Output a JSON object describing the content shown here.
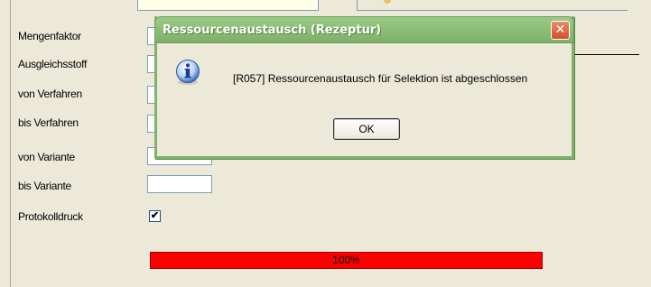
{
  "form": {
    "labels": {
      "mengenfaktor": "Mengenfaktor",
      "ausgleichsstoff": "Ausgleichsstoff",
      "von_verfahren": "von Verfahren",
      "bis_verfahren": "bis Verfahren",
      "von_variante": "von Variante",
      "bis_variante": "bis Variante",
      "protokolldruck": "Protokolldruck"
    },
    "protokolldruck_checked": "✔",
    "progress": {
      "value_percent": 100,
      "label": "100%",
      "color": "#ff0000"
    }
  },
  "dialog": {
    "title": "Ressourcenaustausch (Rezeptur)",
    "close_glyph": "✕",
    "icon": "info-icon",
    "message": "[R057] Ressourcenaustausch für Selektion ist abgeschlossen",
    "ok_label": "OK"
  }
}
